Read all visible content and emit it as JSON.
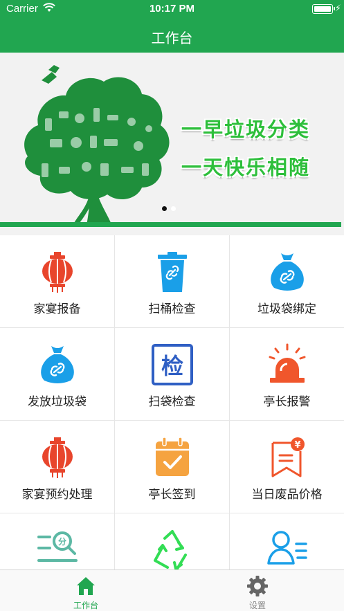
{
  "status_bar": {
    "carrier": "Carrier",
    "time": "10:17 PM"
  },
  "nav": {
    "title": "工作台"
  },
  "banner": {
    "slogan_line1": "一早垃圾分类",
    "slogan_line2": "一天快乐相随",
    "page_count": 2,
    "active_page": 1
  },
  "grid": [
    {
      "label": "家宴报备",
      "icon": "lantern-icon",
      "color": "#e8452c"
    },
    {
      "label": "扫桶检查",
      "icon": "trash-bin-icon",
      "color": "#1a9fe8"
    },
    {
      "label": "垃圾袋绑定",
      "icon": "bag-link-icon",
      "color": "#1a9fe8"
    },
    {
      "label": "发放垃圾袋",
      "icon": "bag-link-icon",
      "color": "#1a9fe8"
    },
    {
      "label": "扫袋检查",
      "icon": "inspect-icon",
      "color": "#2f5fc4"
    },
    {
      "label": "亭长报警",
      "icon": "alarm-icon",
      "color": "#f0562c"
    },
    {
      "label": "家宴预约处理",
      "icon": "lantern-icon",
      "color": "#e8452c"
    },
    {
      "label": "亭长签到",
      "icon": "calendar-check-icon",
      "color": "#f5a340"
    },
    {
      "label": "当日废品价格",
      "icon": "price-tag-icon",
      "color": "#f0562c"
    },
    {
      "label": "",
      "icon": "score-search-icon",
      "color": "#5cb8a4"
    },
    {
      "label": "",
      "icon": "recycle-icon",
      "color": "#33dd55"
    },
    {
      "label": "",
      "icon": "user-list-icon",
      "color": "#1a9fe8"
    }
  ],
  "tabs": [
    {
      "label": "工作台",
      "icon": "home-icon",
      "active": true
    },
    {
      "label": "设置",
      "icon": "gear-icon",
      "active": false
    }
  ],
  "colors": {
    "brand": "#21a650",
    "tab_inactive": "#888888"
  }
}
